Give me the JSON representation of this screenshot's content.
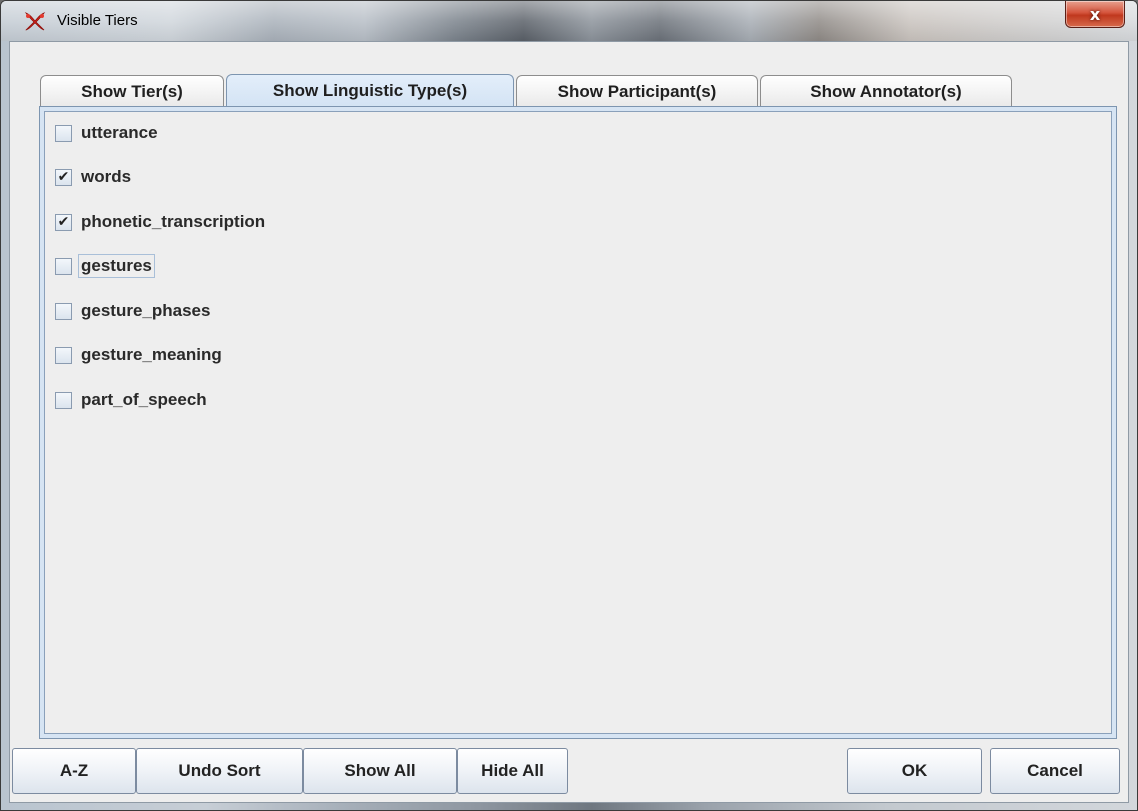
{
  "window": {
    "title": "Visible Tiers",
    "close_glyph": "x",
    "app_icon": "elan-app-icon"
  },
  "tabs": [
    {
      "label": "Show Tier(s)",
      "active": false
    },
    {
      "label": "Show Linguistic Type(s)",
      "active": true
    },
    {
      "label": "Show Participant(s)",
      "active": false
    },
    {
      "label": "Show Annotator(s)",
      "active": false
    }
  ],
  "items": [
    {
      "label": "utterance",
      "checked": false,
      "mark": ""
    },
    {
      "label": "words",
      "checked": true,
      "mark": "✔"
    },
    {
      "label": "phonetic_transcription",
      "checked": true,
      "mark": "✔"
    },
    {
      "label": "gestures",
      "checked": false,
      "mark": "",
      "focused": true
    },
    {
      "label": "gesture_phases",
      "checked": false,
      "mark": ""
    },
    {
      "label": "gesture_meaning",
      "checked": false,
      "mark": ""
    },
    {
      "label": "part_of_speech",
      "checked": false,
      "mark": ""
    }
  ],
  "buttons": {
    "az": "A-Z",
    "undo_sort": "Undo Sort",
    "show_all": "Show All",
    "hide_all": "Hide All",
    "ok": "OK",
    "cancel": "Cancel"
  },
  "colors": {
    "active_tab": "#d3e3f4",
    "panel_border": "#7d95b0",
    "close_button": "#c0381e"
  }
}
